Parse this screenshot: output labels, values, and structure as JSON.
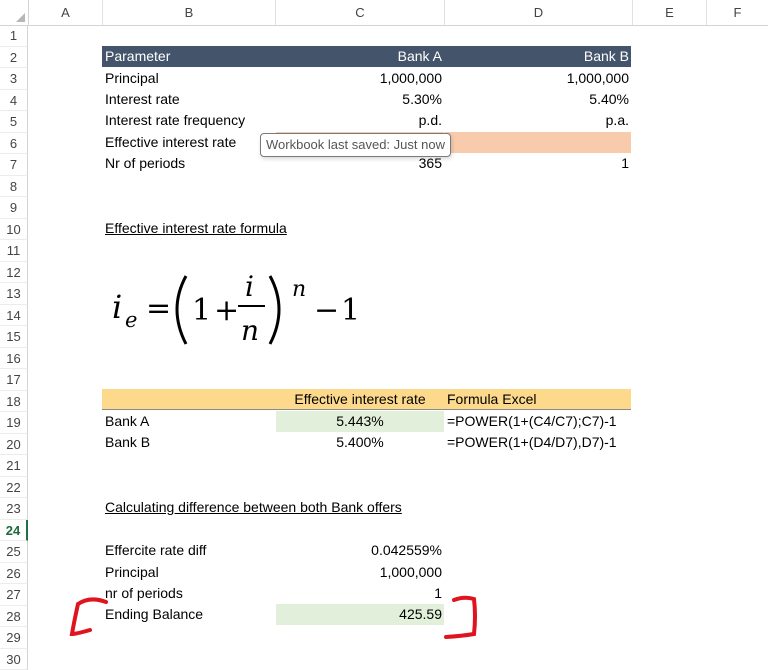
{
  "columns": [
    "A",
    "B",
    "C",
    "D",
    "E",
    "F"
  ],
  "rows": [
    "1",
    "2",
    "3",
    "4",
    "5",
    "6",
    "7",
    "8",
    "9",
    "10",
    "11",
    "12",
    "13",
    "14",
    "15",
    "16",
    "17",
    "18",
    "19",
    "20",
    "21",
    "22",
    "23",
    "24",
    "25",
    "26",
    "27",
    "28",
    "29",
    "30"
  ],
  "selected_row": "24",
  "params_table": {
    "headers": [
      "Parameter",
      "Bank A",
      "Bank B"
    ],
    "rows": [
      [
        "Principal",
        "1,000,000",
        "1,000,000"
      ],
      [
        "Interest rate",
        "5.30%",
        "5.40%"
      ],
      [
        "Interest rate frequency",
        "p.d.",
        "p.a."
      ],
      [
        "Effective interest rate",
        "",
        ""
      ],
      [
        "Nr of periods",
        "365",
        "1"
      ]
    ]
  },
  "tooltip": "Workbook last saved: Just now",
  "formula_title": "Effective interest rate formula",
  "results_table": {
    "headers": [
      "",
      "Effective interest rate",
      "Formula Excel"
    ],
    "rows": [
      [
        "Bank A",
        "5.443%",
        "=POWER(1+(C4/C7);C7)-1"
      ],
      [
        "Bank B",
        "5.400%",
        "=POWER(1+(D4/D7),D7)-1"
      ]
    ]
  },
  "diff_title": "Calculating difference between both Bank offers",
  "diff_rows": [
    [
      "Effercite rate diff",
      "0.042559%"
    ],
    [
      "Principal",
      "1,000,000"
    ],
    [
      "nr of periods",
      "1"
    ],
    [
      "Ending Balance",
      "425.59"
    ]
  ],
  "colors": {
    "header_fill": "#44546a",
    "yellow_fill": "#fcd98b",
    "orange_fill": "#f8cbad",
    "green_fill": "#e2efda",
    "annotation": "#e0141e"
  }
}
